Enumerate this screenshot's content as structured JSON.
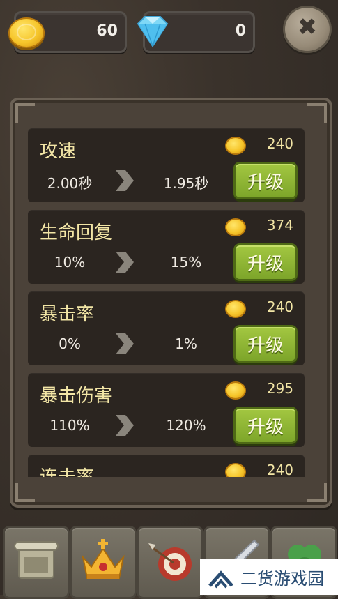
{
  "resources": {
    "gold": "60",
    "gems": "0"
  },
  "close_icon": "✖",
  "upgrades": [
    {
      "name": "攻速",
      "cost": "240",
      "from": "2.00秒",
      "to": "1.95秒",
      "button": "升级"
    },
    {
      "name": "生命回复",
      "cost": "374",
      "from": "10%",
      "to": "15%",
      "button": "升级"
    },
    {
      "name": "暴击率",
      "cost": "240",
      "from": "0%",
      "to": "1%",
      "button": "升级"
    },
    {
      "name": "暴击伤害",
      "cost": "295",
      "from": "110%",
      "to": "120%",
      "button": "升级"
    },
    {
      "name": "连击率",
      "cost": "240",
      "from": "",
      "to": "",
      "button": ""
    }
  ],
  "tabs": [
    "scroll-icon",
    "crown-icon",
    "target-icon",
    "sword-icon",
    "clover-icon"
  ],
  "watermark": "二货游戏园",
  "colors": {
    "accent_green": "#8fb936",
    "gold_text": "#f3e6a6",
    "panel": "#4b4239"
  }
}
